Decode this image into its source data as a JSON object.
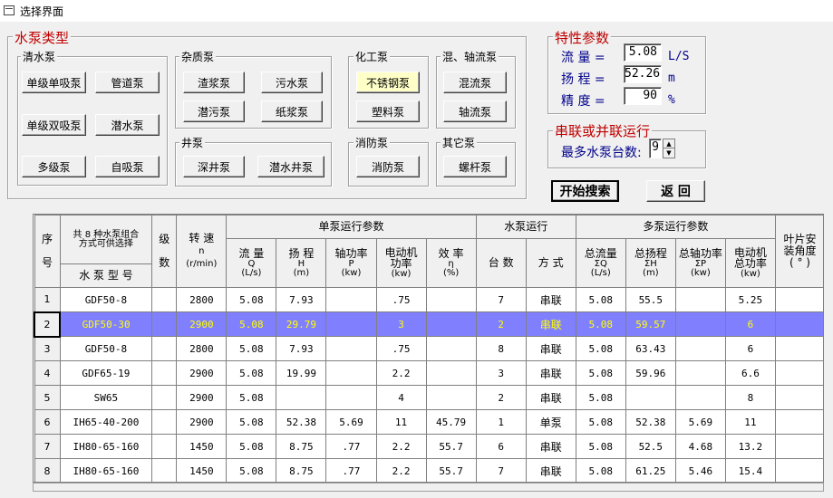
{
  "window": {
    "title": "选择界面"
  },
  "pump_types": {
    "title": "水泵类型",
    "clear_water": {
      "title": "清水泵",
      "buttons": [
        "单级单吸泵",
        "管道泵",
        "单级双吸泵",
        "潜水泵",
        "多级泵",
        "自吸泵"
      ]
    },
    "impurity": {
      "title": "杂质泵",
      "buttons": [
        "渣浆泵",
        "污水泵",
        "潜污泵",
        "纸浆泵"
      ]
    },
    "chemical": {
      "title": "化工泵",
      "buttons": [
        "不锈钢泵",
        "塑料泵"
      ],
      "selected": "不锈钢泵"
    },
    "mixed_flow": {
      "title": "混、轴流泵",
      "buttons": [
        "混流泵",
        "轴流泵"
      ]
    },
    "well": {
      "title": "井泵",
      "buttons": [
        "深井泵",
        "潜水井泵"
      ]
    },
    "fire": {
      "title": "消防泵",
      "buttons": [
        "消防泵"
      ]
    },
    "other": {
      "title": "其它泵",
      "buttons": [
        "螺杆泵"
      ]
    }
  },
  "params": {
    "title": "特性参数",
    "flow": {
      "label": "流  量 =",
      "value": "5.08",
      "unit": "L/S"
    },
    "head": {
      "label": "扬  程 =",
      "value": "52.26",
      "unit": "m"
    },
    "precision": {
      "label": "精  度 =",
      "value": "90",
      "unit": "%"
    }
  },
  "series": {
    "title": "串联或并联运行",
    "max_label": "最多水泵台数:",
    "max_value": "9"
  },
  "actions": {
    "search": "开始搜索",
    "back": "返  回"
  },
  "table": {
    "headers": {
      "seq": [
        "序",
        "号"
      ],
      "combo_note": "共 8 种水泵组合方式可供选择",
      "model": "水 泵 型 号",
      "stages": [
        "级",
        "数"
      ],
      "speed": [
        "转  速",
        "n",
        "(r/min)"
      ],
      "single_group": "单泵运行参数",
      "flow": [
        "流  量",
        "Q",
        "(L/s)"
      ],
      "head": [
        "扬  程",
        "H",
        "(m)"
      ],
      "shaft": [
        "轴功率",
        "P",
        "(kw)"
      ],
      "motor": [
        "电动机",
        "功率",
        "(kw)"
      ],
      "eff": [
        "效  率",
        "η",
        "(%)"
      ],
      "run_group": "水泵运行",
      "count": "台  数",
      "mode": "方  式",
      "multi_group": "多泵运行参数",
      "tflow": [
        "总流量",
        "ΣQ",
        "(L/s)"
      ],
      "thead": [
        "总扬程",
        "ΣH",
        "(m)"
      ],
      "tshaft": [
        "总轴功率",
        "ΣP",
        "(kw)"
      ],
      "tmotor": [
        "电动机",
        "总功率",
        "(kw)"
      ],
      "blade": [
        "叶片安",
        "装角度",
        "( ° )"
      ]
    },
    "rows": [
      {
        "n": "1",
        "model": "GDF50-8",
        "stages": "",
        "speed": "2800",
        "q": "5.08",
        "h": "7.93",
        "p": "",
        "motor": ".75",
        "eff": "",
        "count": "7",
        "mode": "串联",
        "tq": "5.08",
        "th": "55.5",
        "tp": "",
        "tm": "5.25",
        "blade": ""
      },
      {
        "n": "2",
        "model": "GDF50-30",
        "stages": "",
        "speed": "2900",
        "q": "5.08",
        "h": "29.79",
        "p": "",
        "motor": "3",
        "eff": "",
        "count": "2",
        "mode": "串联",
        "tq": "5.08",
        "th": "59.57",
        "tp": "",
        "tm": "6",
        "blade": ""
      },
      {
        "n": "3",
        "model": "GDF50-8",
        "stages": "",
        "speed": "2800",
        "q": "5.08",
        "h": "7.93",
        "p": "",
        "motor": ".75",
        "eff": "",
        "count": "8",
        "mode": "串联",
        "tq": "5.08",
        "th": "63.43",
        "tp": "",
        "tm": "6",
        "blade": ""
      },
      {
        "n": "4",
        "model": "GDF65-19",
        "stages": "",
        "speed": "2900",
        "q": "5.08",
        "h": "19.99",
        "p": "",
        "motor": "2.2",
        "eff": "",
        "count": "3",
        "mode": "串联",
        "tq": "5.08",
        "th": "59.96",
        "tp": "",
        "tm": "6.6",
        "blade": ""
      },
      {
        "n": "5",
        "model": "SW65",
        "stages": "",
        "speed": "2900",
        "q": "5.08",
        "h": "",
        "p": "",
        "motor": "4",
        "eff": "",
        "count": "2",
        "mode": "串联",
        "tq": "5.08",
        "th": "",
        "tp": "",
        "tm": "8",
        "blade": ""
      },
      {
        "n": "6",
        "model": "IH65-40-200",
        "stages": "",
        "speed": "2900",
        "q": "5.08",
        "h": "52.38",
        "p": "5.69",
        "motor": "11",
        "eff": "45.79",
        "count": "1",
        "mode": "单泵",
        "tq": "5.08",
        "th": "52.38",
        "tp": "5.69",
        "tm": "11",
        "blade": ""
      },
      {
        "n": "7",
        "model": "IH80-65-160",
        "stages": "",
        "speed": "1450",
        "q": "5.08",
        "h": "8.75",
        "p": ".77",
        "motor": "2.2",
        "eff": "55.7",
        "count": "6",
        "mode": "串联",
        "tq": "5.08",
        "th": "52.5",
        "tp": "4.68",
        "tm": "13.2",
        "blade": ""
      },
      {
        "n": "8",
        "model": "IH80-65-160",
        "stages": "",
        "speed": "1450",
        "q": "5.08",
        "h": "8.75",
        "p": ".77",
        "motor": "2.2",
        "eff": "55.7",
        "count": "7",
        "mode": "串联",
        "tq": "5.08",
        "th": "61.25",
        "tp": "5.46",
        "tm": "15.4",
        "blade": ""
      }
    ],
    "selected_row": 1
  }
}
